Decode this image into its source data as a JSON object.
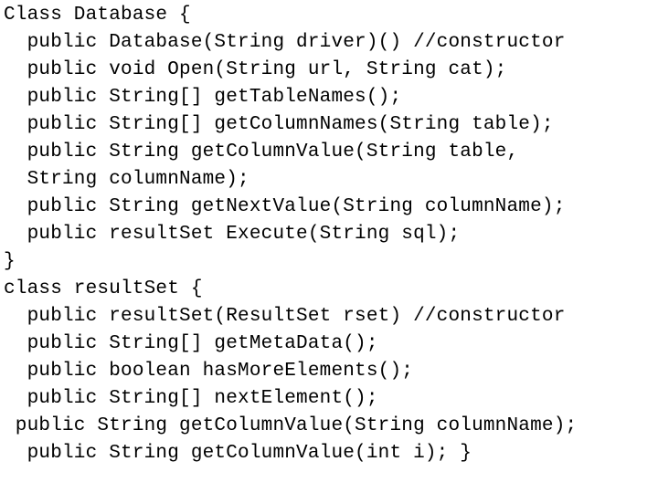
{
  "code": {
    "lines": [
      "Class Database {",
      "  public Database(String driver)() //constructor",
      "  public void Open(String url, String cat);",
      "  public String[] getTableNames();",
      "  public String[] getColumnNames(String table);",
      "  public String getColumnValue(String table,",
      "  String columnName);",
      "  public String getNextValue(String columnName);",
      "  public resultSet Execute(String sql);",
      "}",
      "class resultSet {",
      "  public resultSet(ResultSet rset) //constructor",
      "  public String[] getMetaData();",
      "  public boolean hasMoreElements();",
      "  public String[] nextElement();",
      " public String getColumnValue(String columnName);",
      "  public String getColumnValue(int i); }"
    ]
  }
}
